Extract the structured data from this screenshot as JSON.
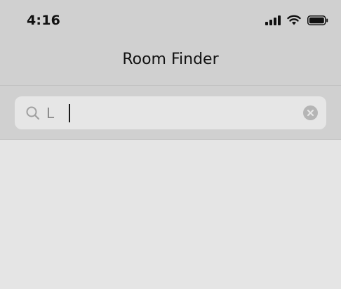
{
  "status_bar": {
    "time": "4:16",
    "icons": [
      "signal-icon",
      "wifi-icon",
      "battery-icon"
    ]
  },
  "nav": {
    "title": "Room Finder"
  },
  "search": {
    "value": "L",
    "icon": "search-icon",
    "clear_icon": "clear-icon"
  },
  "colors": {
    "header_bg": "#d0d0d0",
    "search_bg": "#e6e6e6",
    "content_bg": "#e5e5e5"
  }
}
